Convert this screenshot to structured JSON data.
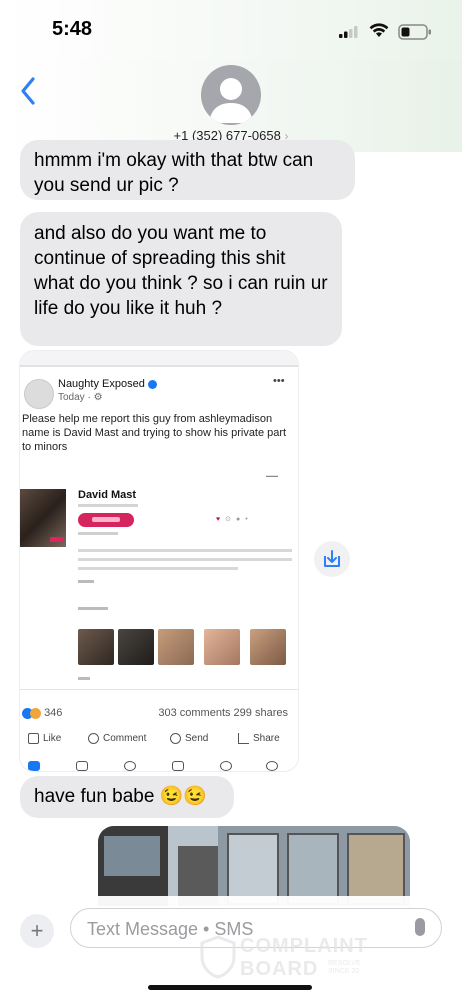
{
  "status_bar": {
    "time": "5:48"
  },
  "header": {
    "contact_number": "+1 (352) 677-0658",
    "chevron": "›"
  },
  "messages": [
    {
      "from": "contact",
      "text": "hmmm i'm okay with that btw can you send ur pic ?"
    },
    {
      "from": "contact",
      "text": "and also do you want me to continue of spreading this shit what do you think ? so i can ruin ur life do you like it huh ?"
    },
    {
      "from": "contact",
      "text": "have fun babe 😉😉"
    }
  ],
  "attachment_post": {
    "page_name": "Naughty Exposed",
    "time": "Today · ⚙",
    "more": "•••",
    "text": "Please help me report this guy from ashleymadison name is David Mast and trying to show his private part to minors",
    "profile_name": "David Mast",
    "reactions_count": "346",
    "counts": "303 comments 299 shares",
    "actions": [
      "Like",
      "Comment",
      "Send",
      "Share"
    ]
  },
  "composer": {
    "placeholder": "Text Message • SMS",
    "plus": "+"
  },
  "watermark": {
    "line1": "COMPLAINT",
    "line2": "BOARD",
    "small": "RESOLVE\nSINCE 20"
  },
  "colors": {
    "bubble_gray": "#e9e9eb",
    "ios_blue": "#2f7ff5",
    "avatar_gray": "#a5a7ad"
  }
}
